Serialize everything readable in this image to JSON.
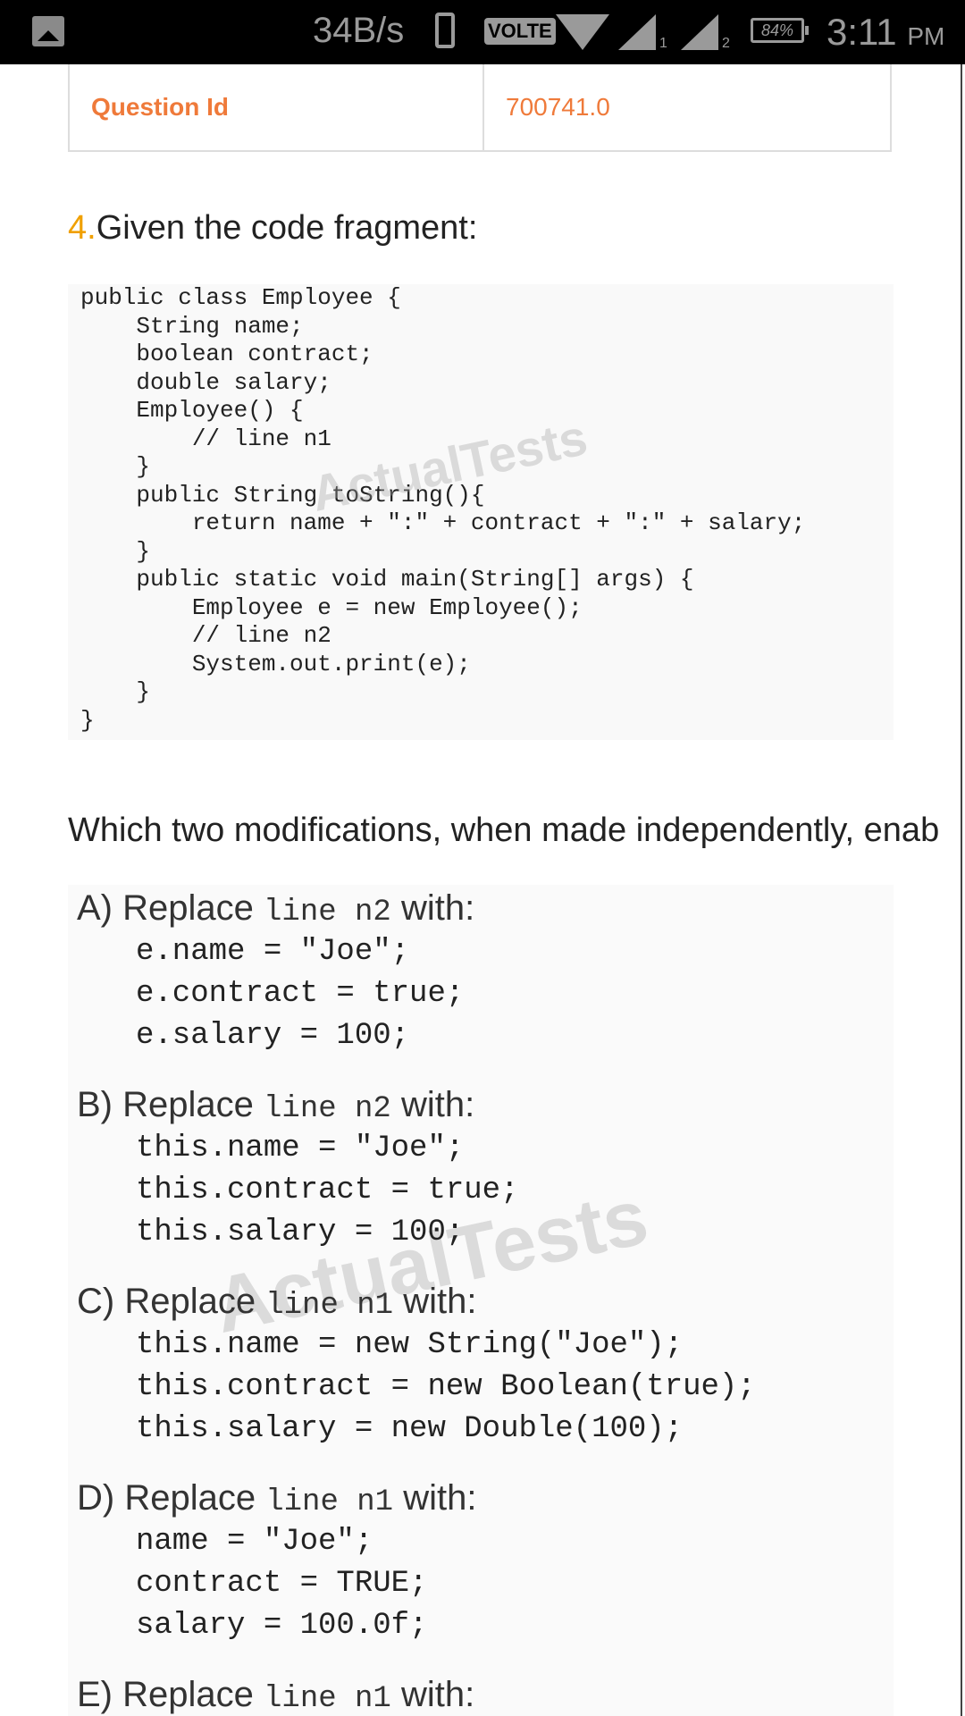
{
  "status_bar": {
    "speed": "34B/s",
    "volte": "VOLTE",
    "sim1": "1",
    "sim2": "2",
    "battery": "84%",
    "time": "3:11",
    "ampm": "PM"
  },
  "table": {
    "label": "Question Id",
    "value": "700741.0",
    "accent_color": "#ef7a3a"
  },
  "question": {
    "number": "4.",
    "heading": "Given the code fragment:",
    "code": "public class Employee {\n    String name;\n    boolean contract;\n    double salary;\n    Employee() {\n        // line n1\n    }\n    public String toString(){\n        return name + \":\" + contract + \":\" + salary;\n    }\n    public static void main(String[] args) {\n        Employee e = new Employee();\n        // line n2\n        System.out.print(e);\n    }\n}",
    "prompt": "Which two modifications, when made independently, enab",
    "watermark": "ActualTests"
  },
  "options": [
    {
      "letter": "A)",
      "word": "Replace",
      "target": "line n2",
      "with": "with:",
      "code": "e.name = \"Joe\";\ne.contract = true;\ne.salary = 100;"
    },
    {
      "letter": "B)",
      "word": "Replace",
      "target": "line n2",
      "with": "with:",
      "code": "this.name = \"Joe\";\nthis.contract = true;\nthis.salary = 100;"
    },
    {
      "letter": "C)",
      "word": "Replace",
      "target": "line n1",
      "with": "with:",
      "code": "this.name = new String(\"Joe\");\nthis.contract = new Boolean(true);\nthis.salary = new Double(100);"
    },
    {
      "letter": "D)",
      "word": "Replace",
      "target": "line n1",
      "with": "with:",
      "code": "name = \"Joe\";\ncontract = TRUE;\nsalary = 100.0f;"
    },
    {
      "letter": "E)",
      "word": "Replace",
      "target": "line n1",
      "with": "with:",
      "code": ""
    }
  ]
}
